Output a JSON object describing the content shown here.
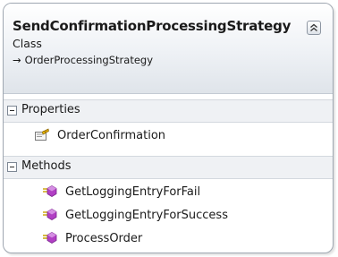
{
  "class": {
    "name": "SendConfirmationProcessingStrategy",
    "kind": "Class",
    "base_class": "OrderProcessingStrategy",
    "base_arrow": "→"
  },
  "sections": {
    "properties": {
      "label": "Properties",
      "items": [
        {
          "label": "OrderConfirmation",
          "icon": "property-icon"
        }
      ]
    },
    "methods": {
      "label": "Methods",
      "items": [
        {
          "label": "GetLoggingEntryForFail",
          "icon": "method-icon"
        },
        {
          "label": "GetLoggingEntryForSuccess",
          "icon": "method-icon"
        },
        {
          "label": "ProcessOrder",
          "icon": "method-icon"
        }
      ]
    }
  },
  "colors": {
    "method_icon": "#b13fc4",
    "header_gradient_end": "#dfe4ea",
    "border": "#9fa7b1"
  }
}
